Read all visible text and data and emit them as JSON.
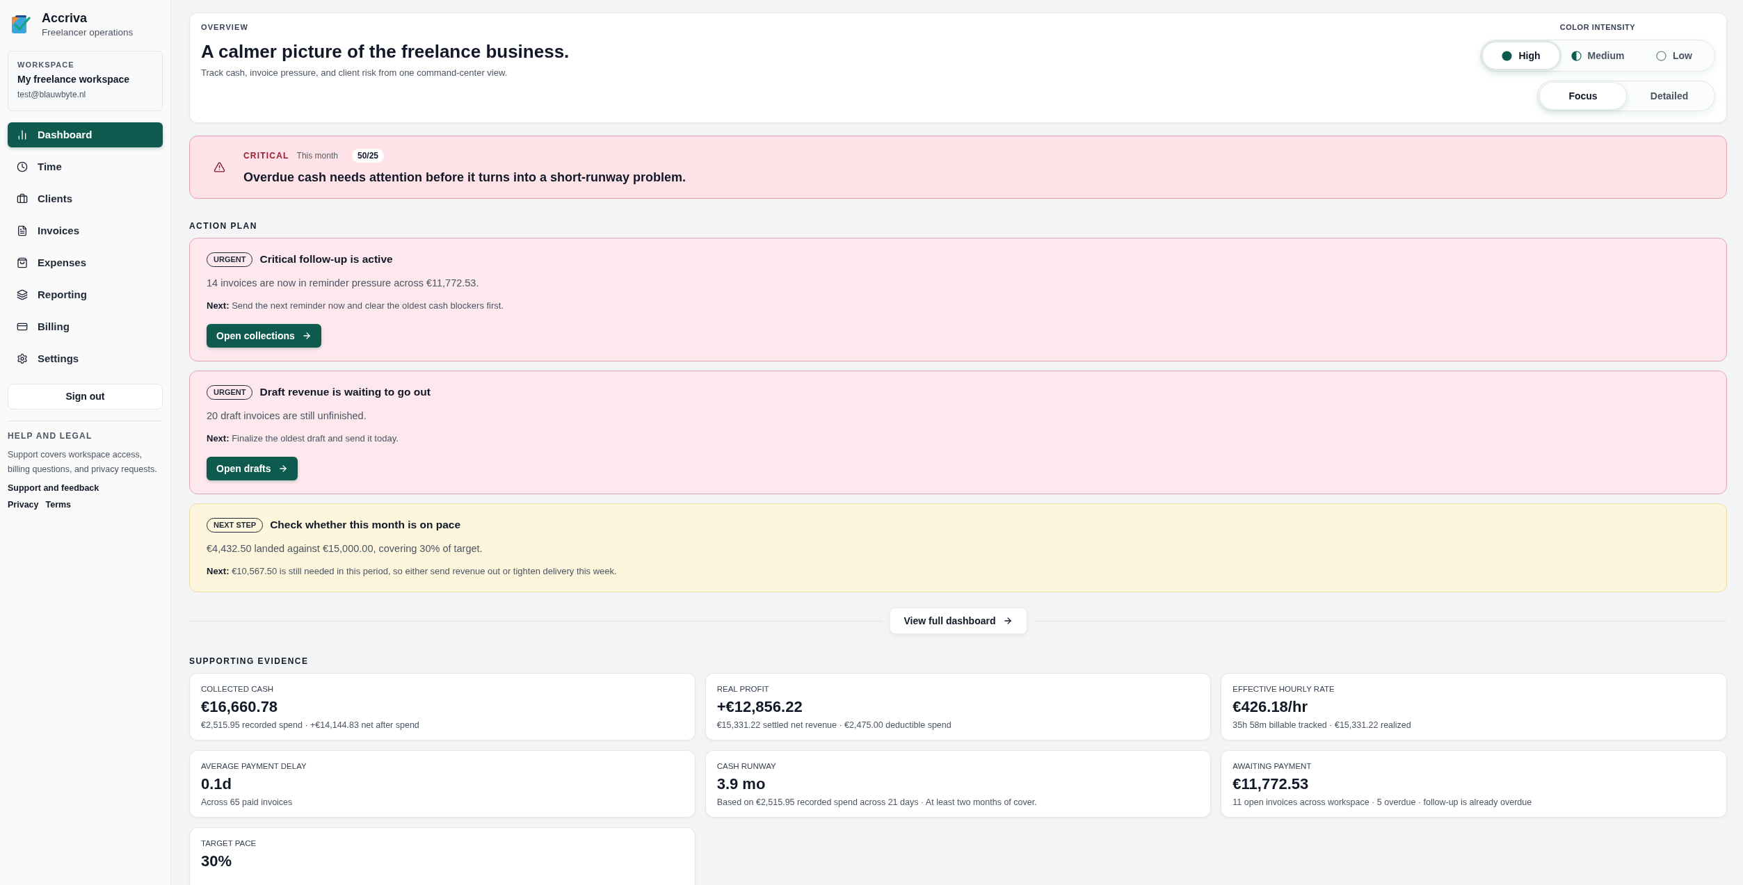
{
  "sidebar": {
    "brand": {
      "name": "Accriva",
      "tagline": "Freelancer operations"
    },
    "workspace": {
      "label": "WORKSPACE",
      "name": "My freelance workspace",
      "email": "test@blauwbyte.nl"
    },
    "nav": [
      {
        "label": "Dashboard",
        "selected": true
      },
      {
        "label": "Time",
        "selected": false
      },
      {
        "label": "Clients",
        "selected": false
      },
      {
        "label": "Invoices",
        "selected": false
      },
      {
        "label": "Expenses",
        "selected": false
      },
      {
        "label": "Reporting",
        "selected": false
      },
      {
        "label": "Billing",
        "selected": false
      },
      {
        "label": "Settings",
        "selected": false
      }
    ],
    "sign_out": "Sign out",
    "help": {
      "title": "HELP AND LEGAL",
      "text": "Support covers workspace access, billing questions, and privacy requests.",
      "support_link": "Support and feedback",
      "legal_links": [
        "Privacy",
        "Terms"
      ]
    }
  },
  "header": {
    "eyebrow": "OVERVIEW",
    "title": "A calmer picture of the freelance business.",
    "subtitle": "Track cash, invoice pressure, and client risk from one command-center view.",
    "color_intensity": {
      "label": "COLOR INTENSITY",
      "options": [
        {
          "label": "High",
          "kind": "full",
          "selected": true
        },
        {
          "label": "Medium",
          "kind": "half",
          "selected": false
        },
        {
          "label": "Low",
          "kind": "empty",
          "selected": false
        }
      ]
    },
    "view_mode": {
      "options": [
        {
          "label": "Focus",
          "selected": true
        },
        {
          "label": "Detailed",
          "selected": false
        }
      ]
    }
  },
  "alert": {
    "kind": "critical",
    "severity": "CRITICAL",
    "period": "This month",
    "count": "50/25",
    "message": "Overdue cash needs attention before it turns into a short-runway problem."
  },
  "action_plan": {
    "title": "ACTION PLAN",
    "items": [
      {
        "kind": "urgent",
        "badge": "URGENT",
        "title": "Critical follow-up is active",
        "body": "14 invoices are now in reminder pressure across €11,772.53.",
        "next": "**Next:** Send the next reminder now and clear the oldest cash blockers first.",
        "button": "Open collections"
      },
      {
        "kind": "urgent",
        "badge": "URGENT",
        "title": "Draft revenue is waiting to go out",
        "body": "20 draft invoices are still unfinished.",
        "next": "**Next:** Finalize the oldest draft and send it today.",
        "button": "Open drafts"
      },
      {
        "kind": "next_step",
        "badge": "NEXT STEP",
        "title": "Check whether this month is on pace",
        "body": "€4,432.50 landed against €15,000.00, covering 30% of target.",
        "next": "**Next:** €10,567.50 is still needed in this period, so either send revenue out or tighten delivery this week."
      }
    ]
  },
  "dashboard_link": "View full dashboard",
  "evidence": {
    "title": "SUPPORTING EVIDENCE",
    "metrics": [
      {
        "label": "COLLECTED CASH",
        "value": "€16,660.78",
        "detail": "€2,515.95 recorded spend · +€14,144.83 net after spend"
      },
      {
        "label": "REAL PROFIT",
        "value": "+€12,856.22",
        "detail": "€15,331.22 settled net revenue · €2,475.00 deductible spend"
      },
      {
        "label": "EFFECTIVE HOURLY RATE",
        "value": "€426.18/hr",
        "detail": "35h 58m billable tracked · €15,331.22 realized"
      },
      {
        "label": "AVERAGE PAYMENT DELAY",
        "value": "0.1d",
        "detail": "Across 65 paid invoices"
      },
      {
        "label": "CASH RUNWAY",
        "value": "3.9 mo",
        "detail": "Based on €2,515.95 recorded spend across 21 days · At least two months of cover."
      },
      {
        "label": "AWAITING PAYMENT",
        "value": "€11,772.53",
        "detail": "11 open invoices across workspace · 5 overdue · follow-up is already overdue"
      },
      {
        "label": "TARGET PACE",
        "value": "30%"
      }
    ]
  }
}
